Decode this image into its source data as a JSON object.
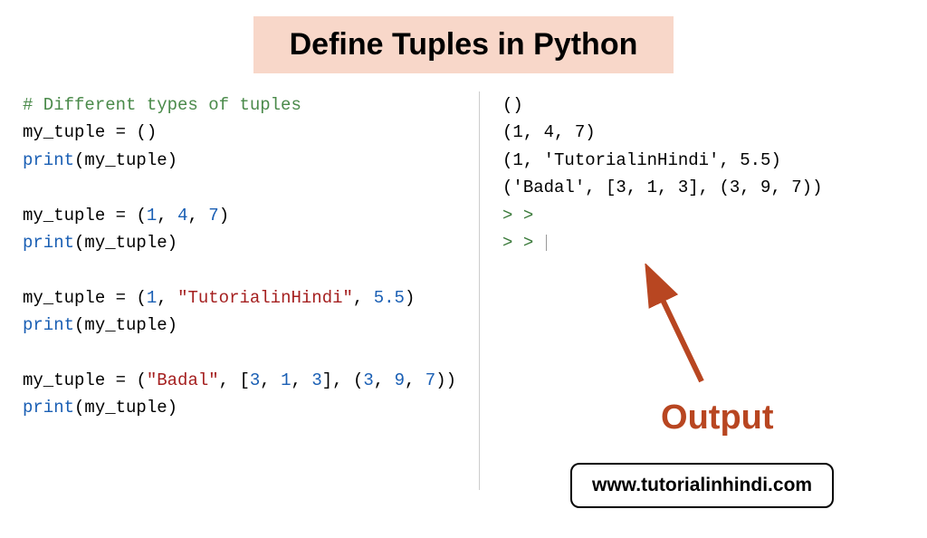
{
  "title": "Define Tuples in Python",
  "code": {
    "comment": "# Different types of tuples",
    "var": "my_tuple",
    "func_print": "print",
    "assign1_open": " = ()",
    "print_call": "(my_tuple)",
    "nums1": [
      "1",
      "4",
      "7"
    ],
    "mixed_num1": "1",
    "mixed_str": "\"TutorialinHindi\"",
    "mixed_num2": "5.5",
    "nested_str": "\"Badal\"",
    "nested_list": [
      "3",
      "1",
      "3"
    ],
    "nested_tuple": [
      "3",
      "9",
      "7"
    ]
  },
  "output": {
    "line1": "()",
    "line2": "(1, 4, 7)",
    "line3": "(1, 'TutorialinHindi', 5.5)",
    "line4": "('Badal', [3, 1, 3], (3, 9, 7))",
    "prompt": "> >"
  },
  "output_label": "Output",
  "website": "www.tutorialinhindi.com"
}
